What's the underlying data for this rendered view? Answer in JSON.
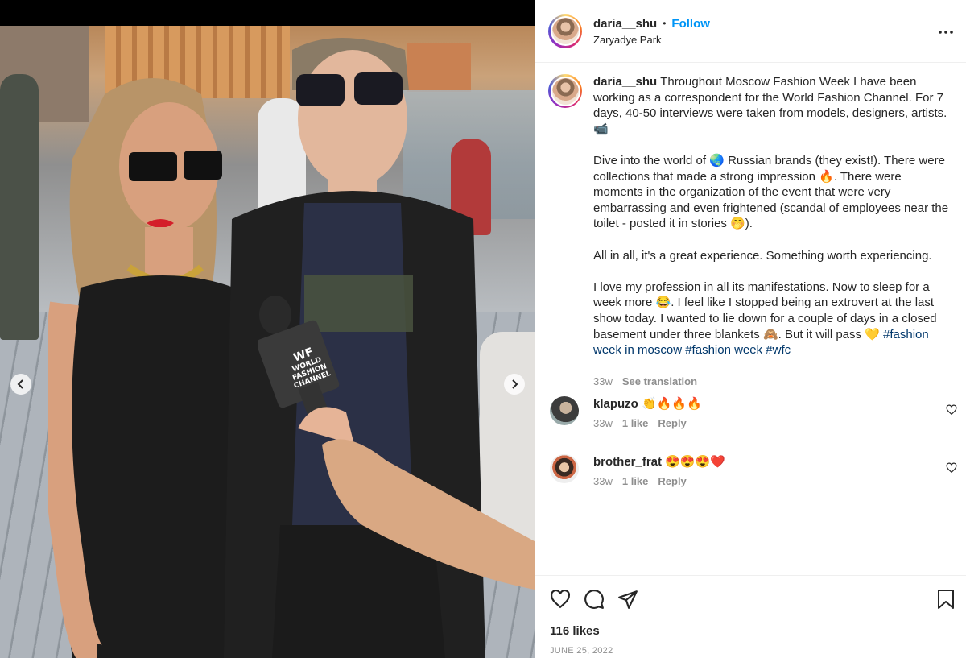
{
  "post": {
    "username": "daria__shu",
    "separator": "•",
    "follow_label": "Follow",
    "location": "Zaryadye Park"
  },
  "media": {
    "mic_text_1": "WORLD",
    "mic_text_2": "FASHION",
    "mic_text_3": "CHANNEL",
    "mic_logo": "WF"
  },
  "caption": {
    "username": "daria__shu",
    "p1": "Throughout Moscow Fashion Week I have been working as a correspondent for the World Fashion Channel. For 7 days, 40-50 interviews were taken from models, designers, artists. 📹",
    "p2": "Dive into the world of 🌏 Russian brands (they exist!). There were collections that made a strong impression 🔥. There were moments in the organization of the event that were very embarrassing and even frightened (scandal of employees near the toilet - posted it in stories 🤭).",
    "p3": "All in all, it's a great experience. Something worth experiencing.",
    "p4_text": "I love my profession in all its manifestations. Now to sleep for a week more 😂. I feel like I stopped being an extrovert at the last show today. I wanted to lie down for a couple of days in a closed basement under three blankets 🙈. But it will pass 💛 ",
    "tags": [
      "#fashion week in moscow",
      "#fashion week",
      "#wfc"
    ],
    "time": "33w",
    "see_translation": "See translation"
  },
  "comments": [
    {
      "username": "klapuzo",
      "text": "👏🔥🔥🔥",
      "time": "33w",
      "likes": "1 like",
      "reply": "Reply"
    },
    {
      "username": "brother_frat",
      "text": "😍😍😍❤️",
      "time": "33w",
      "likes": "1 like",
      "reply": "Reply"
    }
  ],
  "footer": {
    "likes": "116 likes",
    "date": "JUNE 25, 2022"
  },
  "colors": {
    "link_blue": "#0095f6",
    "tag_blue": "#00376b",
    "muted": "#8e8e8e"
  }
}
